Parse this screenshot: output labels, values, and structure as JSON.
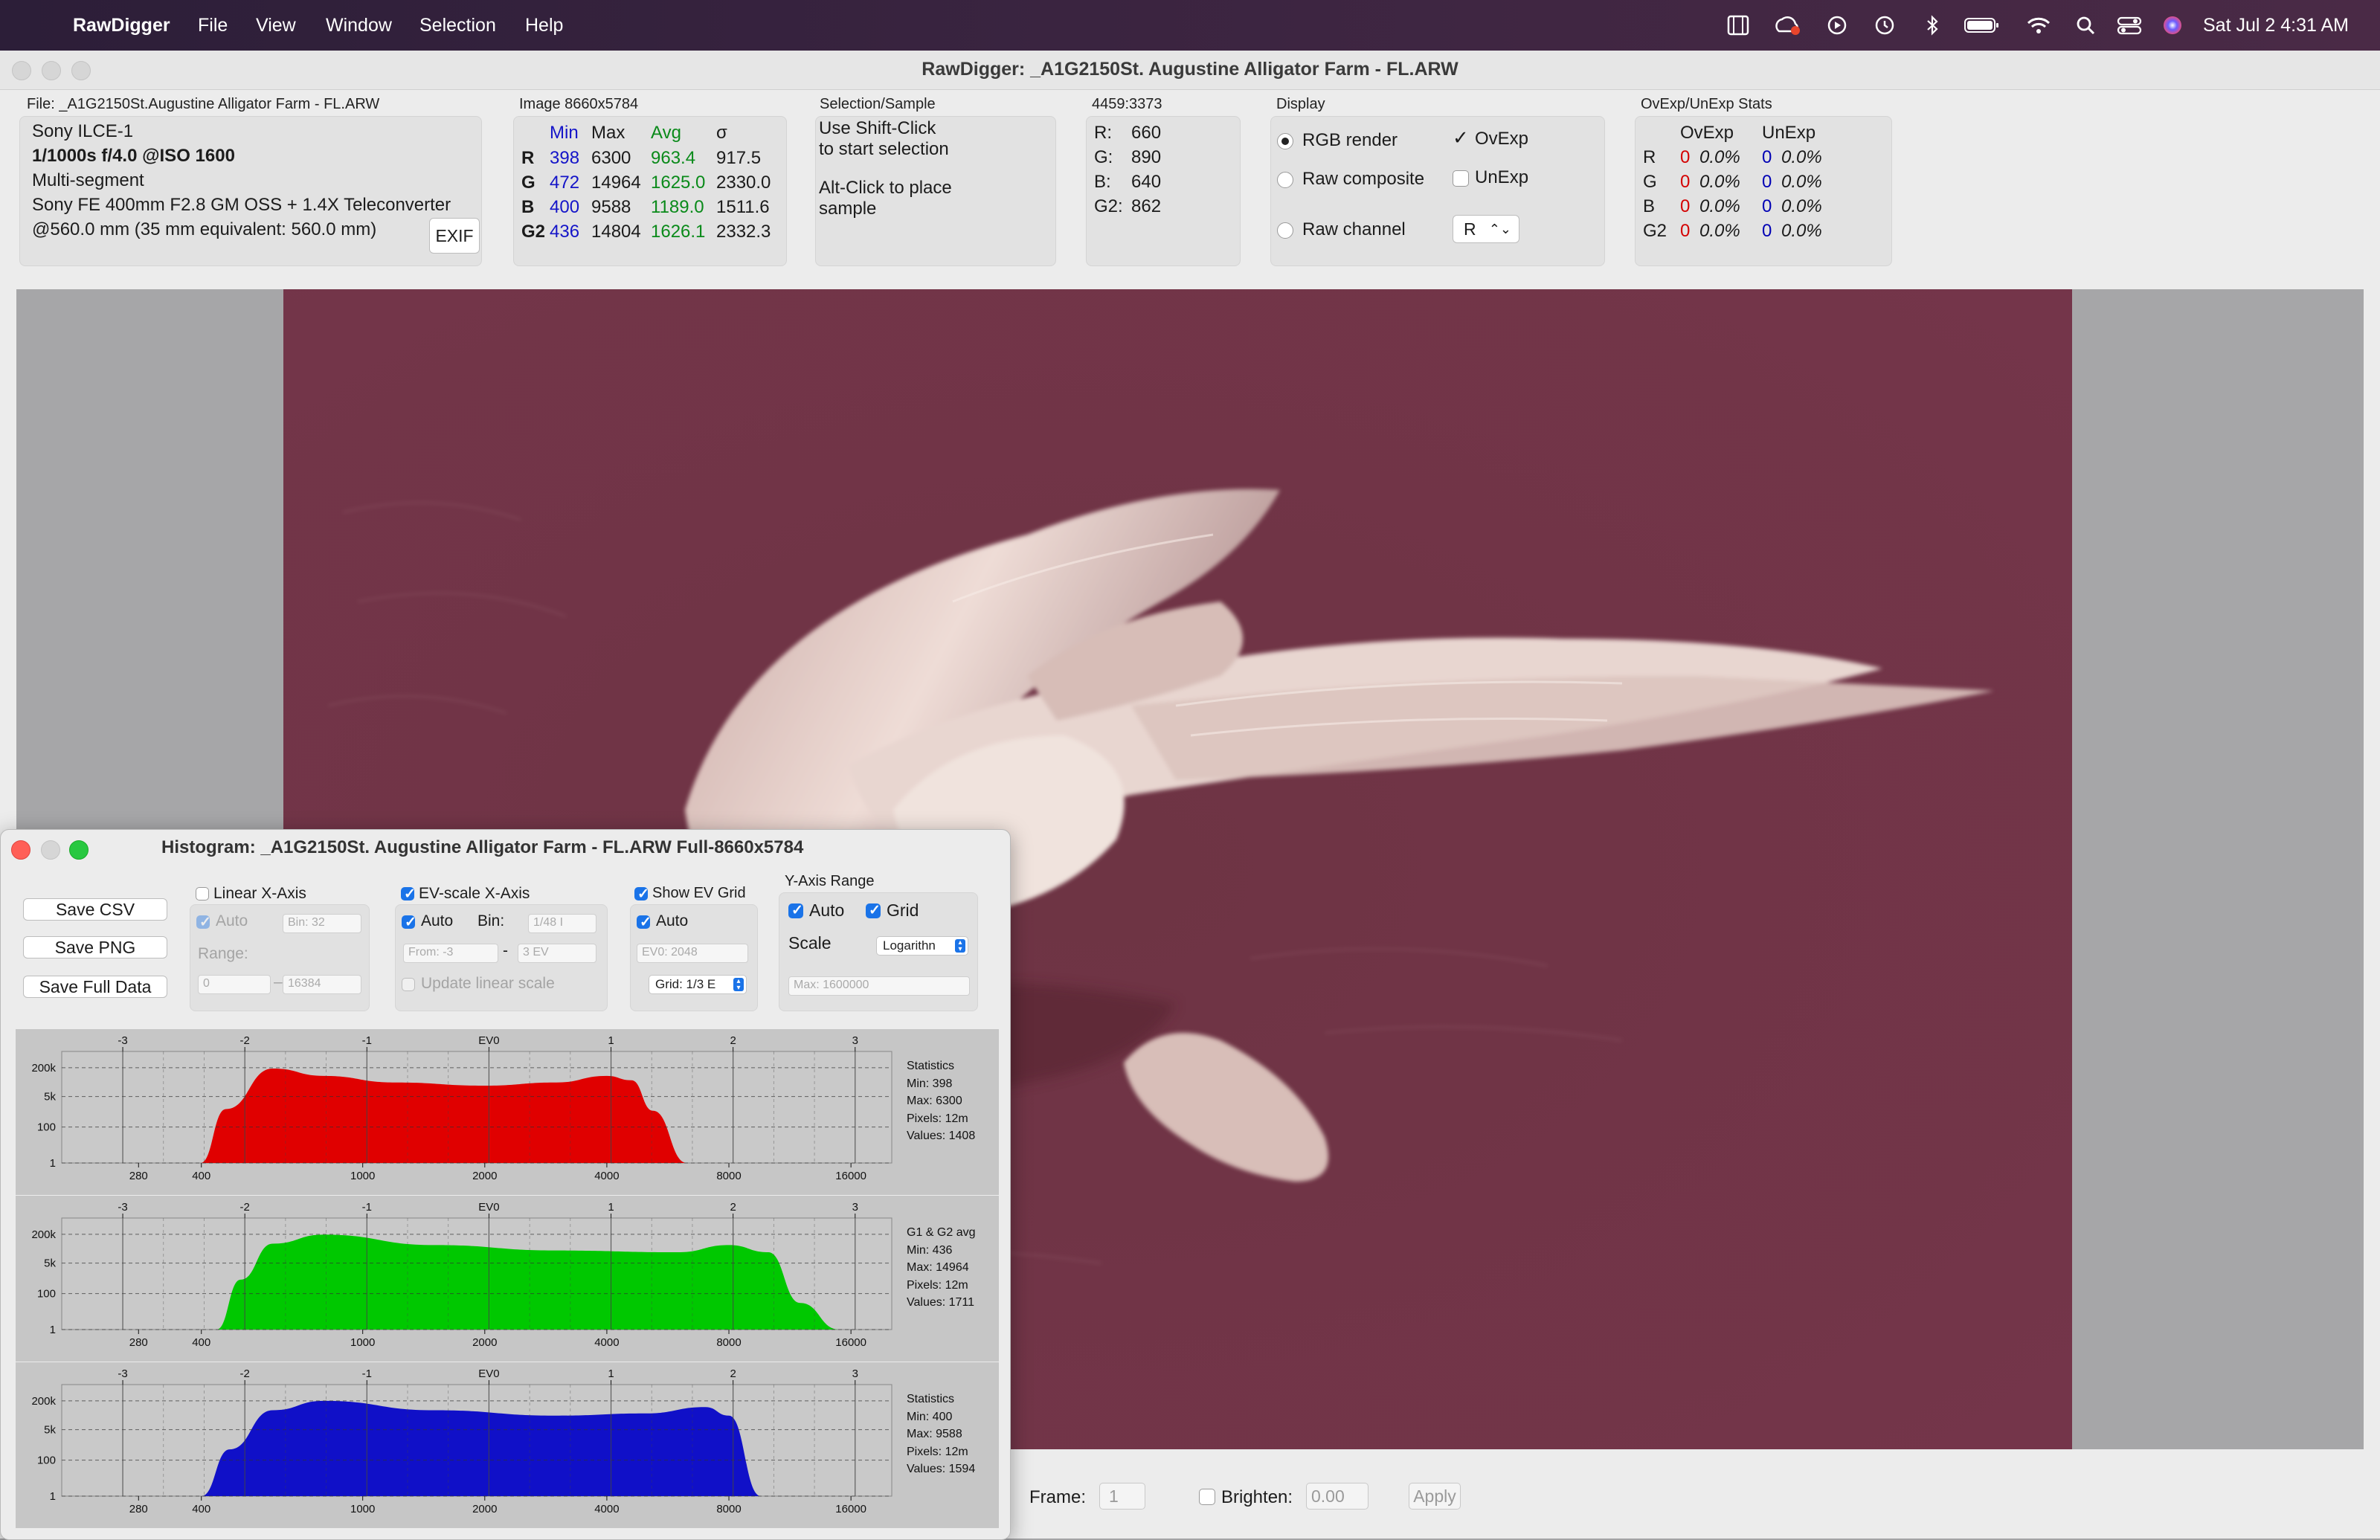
{
  "menubar": {
    "app_name": "RawDigger",
    "items": [
      "File",
      "View",
      "Window",
      "Selection",
      "Help"
    ],
    "clock": "Sat Jul 2  4:31 AM",
    "status_icons": [
      "film-icon",
      "creative-cloud-icon",
      "play-icon",
      "time-machine-icon",
      "bluetooth-icon",
      "battery-icon",
      "wifi-icon",
      "spotlight-search-icon",
      "control-center-icon",
      "siri-icon"
    ]
  },
  "window": {
    "title": "RawDigger: _A1G2150St. Augustine Alligator Farm -  FL.ARW"
  },
  "file_panel": {
    "label": "File: _A1G2150St.Augustine Alligator Farm -  FL.ARW",
    "camera": "Sony ILCE-1",
    "exposure": "1/1000s f/4.0 @ISO 1600",
    "mode": "Multi-segment",
    "lens": "Sony FE 400mm F2.8 GM OSS + 1.4X Teleconverter",
    "focal": "@560.0 mm (35 mm equivalent: 560.0 mm)",
    "exif_button": "EXIF"
  },
  "image_panel": {
    "label": "Image 8660x5784",
    "headers": [
      "Min",
      "Max",
      "Avg",
      "σ"
    ],
    "rows": [
      {
        "ch": "R",
        "min": "398",
        "max": "6300",
        "avg": "963.4",
        "sigma": "917.5"
      },
      {
        "ch": "G",
        "min": "472",
        "max": "14964",
        "avg": "1625.0",
        "sigma": "2330.0"
      },
      {
        "ch": "B",
        "min": "400",
        "max": "9588",
        "avg": "1189.0",
        "sigma": "1511.6"
      },
      {
        "ch": "G2",
        "min": "436",
        "max": "14804",
        "avg": "1626.1",
        "sigma": "2332.3"
      }
    ]
  },
  "selection_panel": {
    "label": "Selection/Sample",
    "line1": "Use Shift-Click",
    "line2": "to start selection",
    "line3": "Alt-Click to place",
    "line4": "sample"
  },
  "coords_panel": {
    "label": "4459:3373",
    "rows": [
      {
        "ch": "R:",
        "val": "660"
      },
      {
        "ch": "G:",
        "val": "890"
      },
      {
        "ch": "B:",
        "val": "640"
      },
      {
        "ch": "G2:",
        "val": "862"
      }
    ]
  },
  "display_panel": {
    "label": "Display",
    "rgb_render": "RGB render",
    "raw_composite": "Raw composite",
    "raw_channel": "Raw channel",
    "ovexp": "OvExp",
    "unexp": "UnExp",
    "channel_value": "R"
  },
  "ovexp_panel": {
    "label": "OvExp/UnExp Stats",
    "headers": [
      "OvExp",
      "UnExp"
    ],
    "rows": [
      {
        "ch": "R",
        "ov": "0",
        "ovp": "0.0%",
        "un": "0",
        "unp": "0.0%"
      },
      {
        "ch": "G",
        "ov": "0",
        "ovp": "0.0%",
        "un": "0",
        "unp": "0.0%"
      },
      {
        "ch": "B",
        "ov": "0",
        "ovp": "0.0%",
        "un": "0",
        "unp": "0.0%"
      },
      {
        "ch": "G2",
        "ov": "0",
        "ovp": "0.0%",
        "un": "0",
        "unp": "0.0%"
      }
    ]
  },
  "bottom_bar": {
    "frame_label": "Frame:",
    "frame_value": "1",
    "brighten_label": "Brighten:",
    "brighten_value": "0.00",
    "apply": "Apply"
  },
  "histogram": {
    "title": "Histogram: _A1G2150St. Augustine Alligator Farm -  FL.ARW Full-8660x5784",
    "buttons": [
      "Save CSV",
      "Save PNG",
      "Save Full Data"
    ],
    "linear": {
      "title": "Linear X-Axis",
      "auto": "Auto",
      "bin": "Bin: 32",
      "range": "Range:",
      "from": "0",
      "to": "16384"
    },
    "ev": {
      "title": "EV-scale X-Axis",
      "auto": "Auto",
      "bin_label": "Bin:",
      "bin": "1/48 I",
      "from": "From: -3",
      "to": "3 EV",
      "update": "Update linear scale"
    },
    "grid": {
      "title": "Show EV Grid",
      "auto": "Auto",
      "ev0": "EV0: 2048",
      "grid": "Grid: 1/3 E"
    },
    "yaxis": {
      "title": "Y-Axis Range",
      "auto": "Auto",
      "grid": "Grid",
      "scale_label": "Scale",
      "scale": "Logarithn",
      "max": "Max: 1600000"
    },
    "panels": [
      {
        "color": "#e00000",
        "stats": [
          "Statistics",
          "Min: 398",
          "Max: 6300",
          "Pixels: 12m",
          "Values: 1408"
        ]
      },
      {
        "color": "#00c800",
        "stats": [
          "G1 & G2 avg",
          "Min: 436",
          "Max: 14964",
          "Pixels: 12m",
          "Values: 1711"
        ]
      },
      {
        "color": "#1010c8",
        "stats": [
          "Statistics",
          "Min: 400",
          "Max: 9588",
          "Pixels: 12m",
          "Values: 1594"
        ]
      }
    ]
  },
  "chart_data": [
    {
      "type": "area",
      "x_scale": "log2 (EV)",
      "ev_ticks": [
        "-3",
        "-2",
        "-1",
        "EV0",
        "1",
        "2",
        "3"
      ],
      "value_ticks": [
        "280",
        "400",
        "1000",
        "2000",
        "4000",
        "8000",
        "16000"
      ],
      "y_ticks": [
        "200k",
        "5k",
        "100",
        "1"
      ],
      "series": [
        {
          "name": "R",
          "color": "#e00000",
          "x": [
            398,
            460,
            600,
            800,
            1200,
            2000,
            3000,
            4000,
            4600,
            5200,
            6300
          ],
          "y": [
            1,
            1000,
            180000,
            70000,
            30000,
            20000,
            30000,
            70000,
            40000,
            800,
            1
          ]
        },
        {
          "name": "G1 & G2 avg",
          "color": "#00c800",
          "x": [
            436,
            500,
            600,
            800,
            1500,
            3000,
            6000,
            8000,
            10000,
            12000,
            14964
          ],
          "y": [
            1,
            600,
            60000,
            190000,
            50000,
            25000,
            20000,
            50000,
            20000,
            30,
            1
          ]
        },
        {
          "name": "B",
          "color": "#1010c8",
          "x": [
            400,
            470,
            600,
            800,
            1500,
            3000,
            5000,
            7000,
            8000,
            9588
          ],
          "y": [
            1,
            400,
            60000,
            200000,
            60000,
            30000,
            40000,
            90000,
            30000,
            1
          ]
        }
      ]
    }
  ]
}
